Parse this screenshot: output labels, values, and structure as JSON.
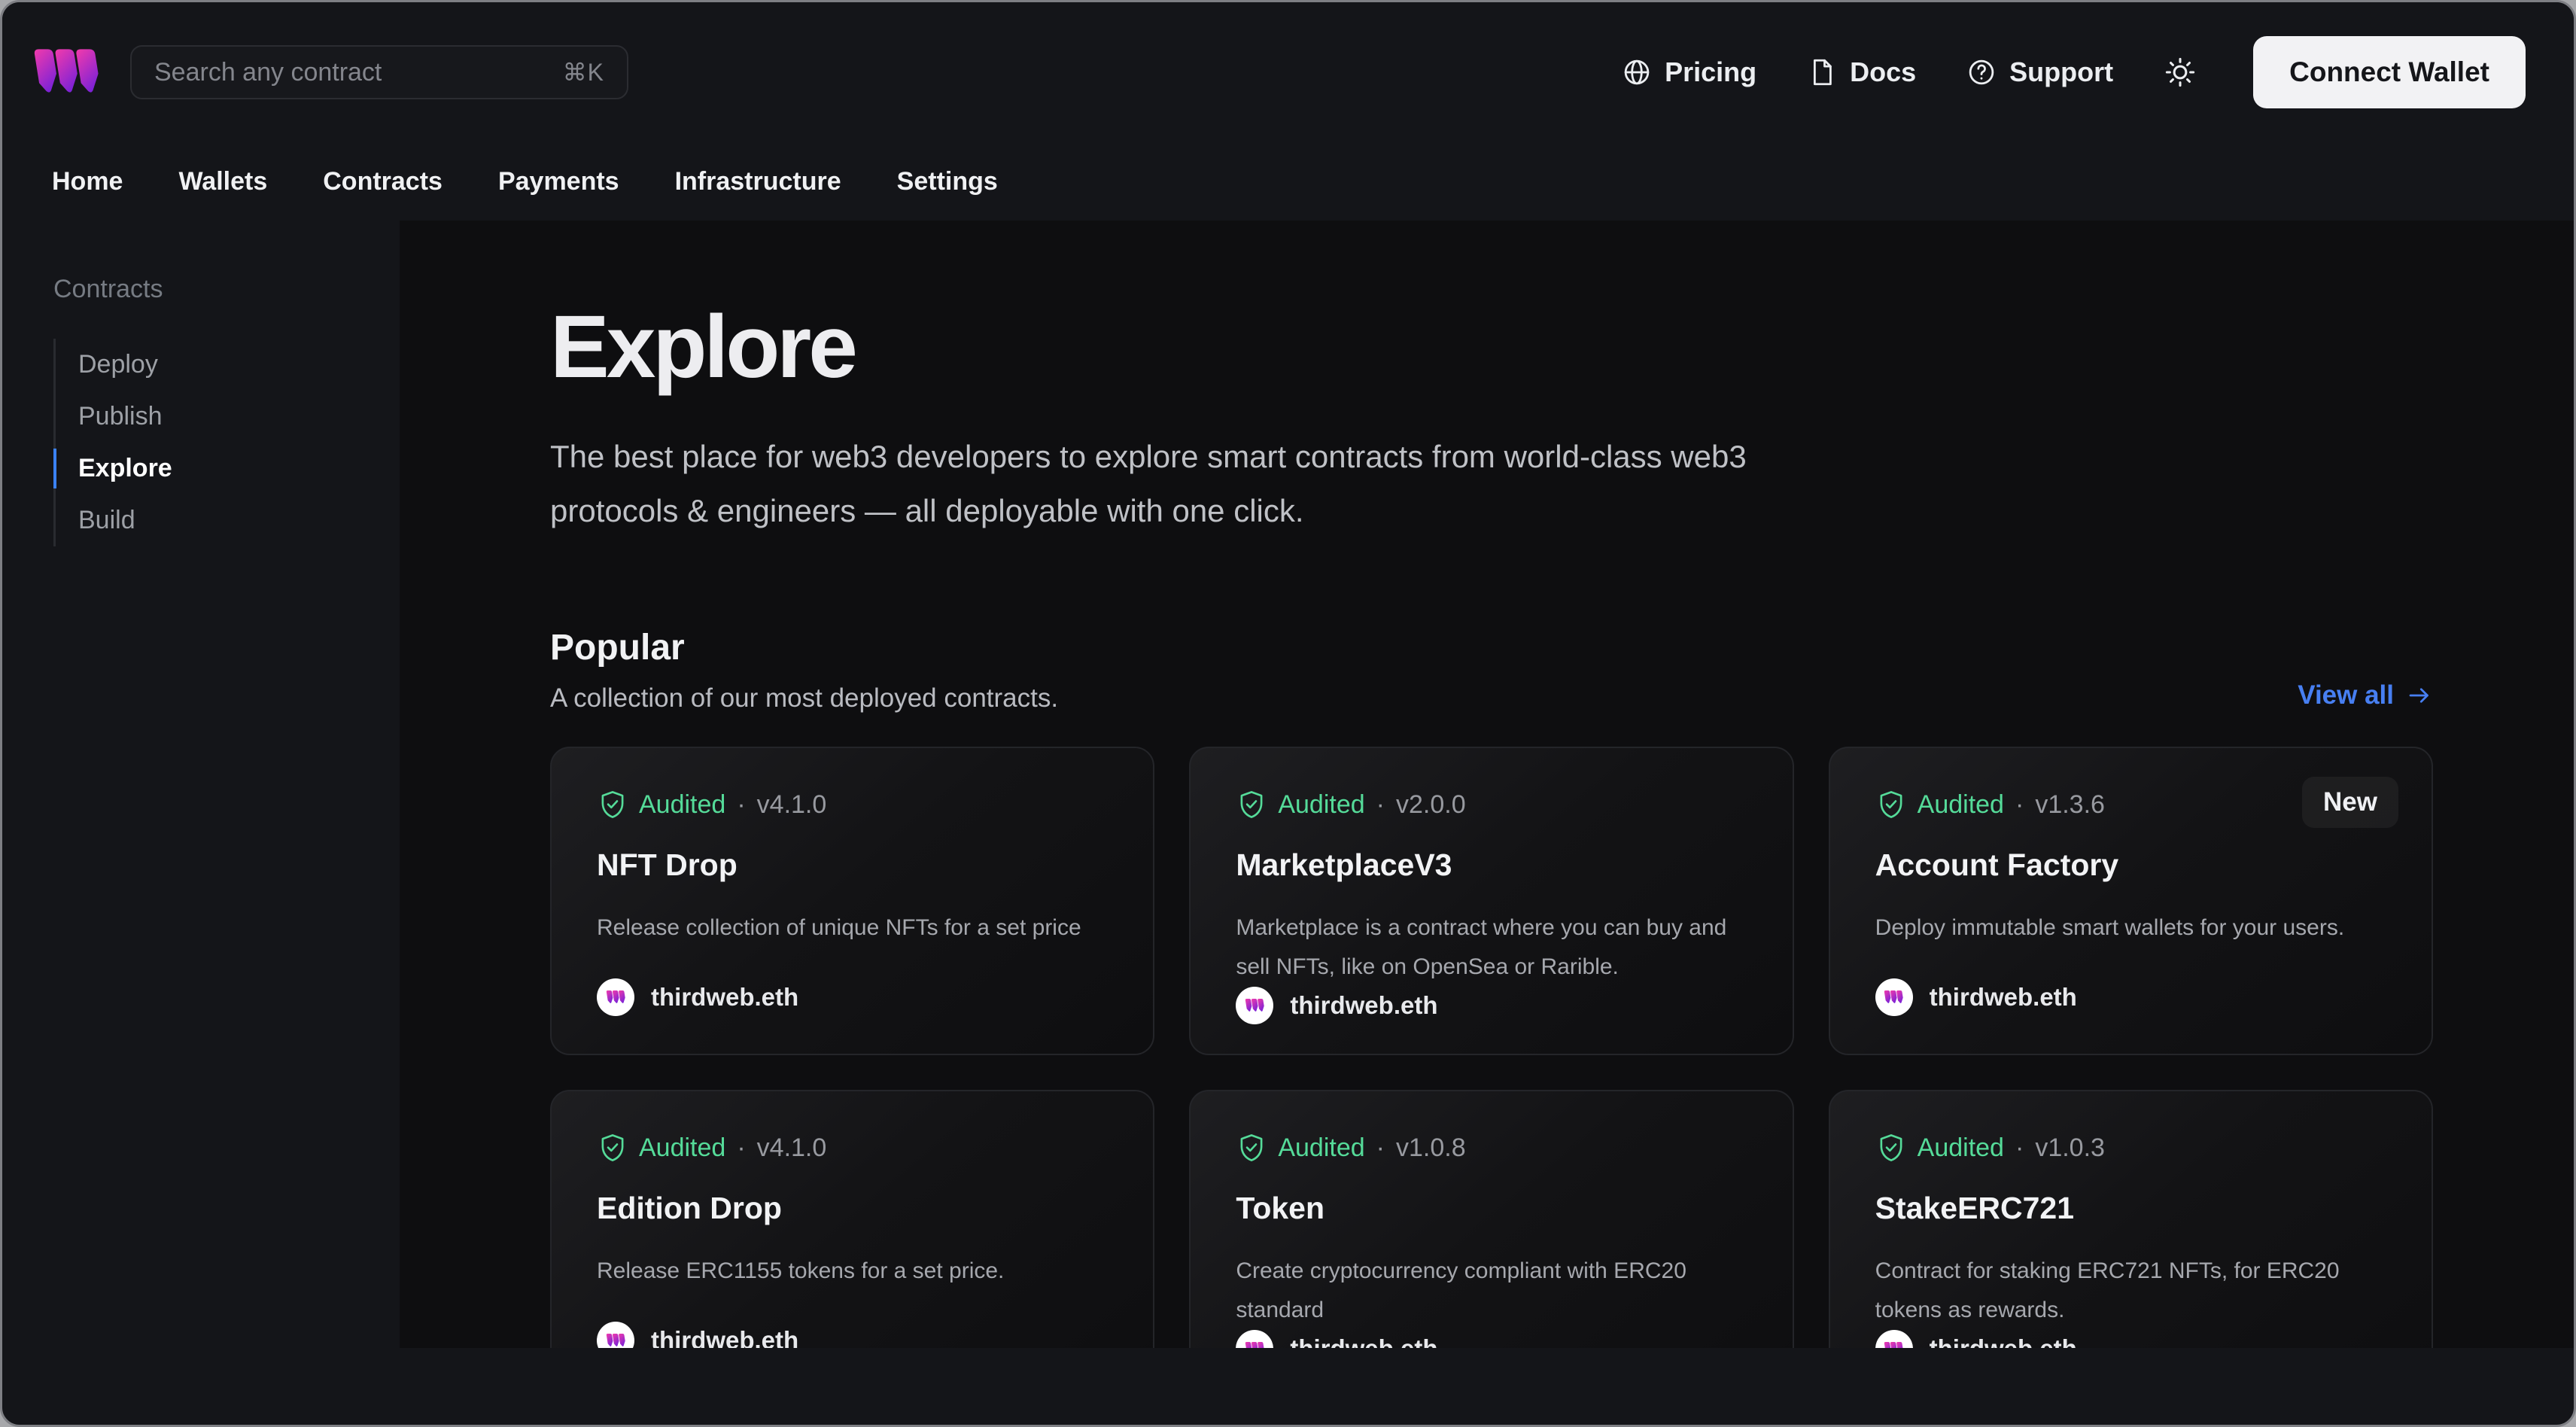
{
  "topbar": {
    "search": {
      "placeholder": "Search any contract",
      "shortcut": "⌘K"
    },
    "links": [
      {
        "label": "Pricing",
        "icon": "globe-icon"
      },
      {
        "label": "Docs",
        "icon": "docs-icon"
      },
      {
        "label": "Support",
        "icon": "help-icon"
      }
    ],
    "connect_wallet_label": "Connect Wallet"
  },
  "tabs": [
    {
      "label": "Home"
    },
    {
      "label": "Wallets"
    },
    {
      "label": "Contracts"
    },
    {
      "label": "Payments"
    },
    {
      "label": "Infrastructure"
    },
    {
      "label": "Settings"
    }
  ],
  "sidebar": {
    "heading": "Contracts",
    "items": [
      {
        "label": "Deploy",
        "active": false
      },
      {
        "label": "Publish",
        "active": false
      },
      {
        "label": "Explore",
        "active": true
      },
      {
        "label": "Build",
        "active": false
      }
    ]
  },
  "main": {
    "title": "Explore",
    "subtitle": "The best place for web3 developers to explore smart contracts from world-class web3 protocols & engineers — all deployable with one click.",
    "dot": "·",
    "popular": {
      "heading": "Popular",
      "subheading": "A collection of our most deployed contracts.",
      "view_all_label": "View all"
    },
    "cards": [
      {
        "audited": "Audited",
        "version": "v4.1.0",
        "title": "NFT Drop",
        "description": "Release collection of unique NFTs for a set price",
        "publisher": "thirdweb.eth",
        "badge": ""
      },
      {
        "audited": "Audited",
        "version": "v2.0.0",
        "title": "MarketplaceV3",
        "description": "Marketplace is a contract where you can buy and sell NFTs, like on OpenSea or Rarible.",
        "publisher": "thirdweb.eth",
        "badge": ""
      },
      {
        "audited": "Audited",
        "version": "v1.3.6",
        "title": "Account Factory",
        "description": "Deploy immutable smart wallets for your users.",
        "publisher": "thirdweb.eth",
        "badge": "New"
      },
      {
        "audited": "Audited",
        "version": "v4.1.0",
        "title": "Edition Drop",
        "description": "Release ERC1155 tokens for a set price.",
        "publisher": "thirdweb.eth",
        "badge": ""
      },
      {
        "audited": "Audited",
        "version": "v1.0.8",
        "title": "Token",
        "description": "Create cryptocurrency compliant with ERC20 standard",
        "publisher": "thirdweb.eth",
        "badge": ""
      },
      {
        "audited": "Audited",
        "version": "v1.0.3",
        "title": "StakeERC721",
        "description": "Contract for staking ERC721 NFTs, for ERC20 tokens as rewards.",
        "publisher": "thirdweb.eth",
        "badge": ""
      }
    ]
  },
  "colors": {
    "header_bg": "#141519",
    "main_bg": "#0e0e10",
    "accent_blue": "#3b82f6",
    "audited_green": "#55db99",
    "brand_pink": "#ef2ba2",
    "brand_purple": "#8426d8",
    "connect_button_bg": "#f2f2f4"
  }
}
